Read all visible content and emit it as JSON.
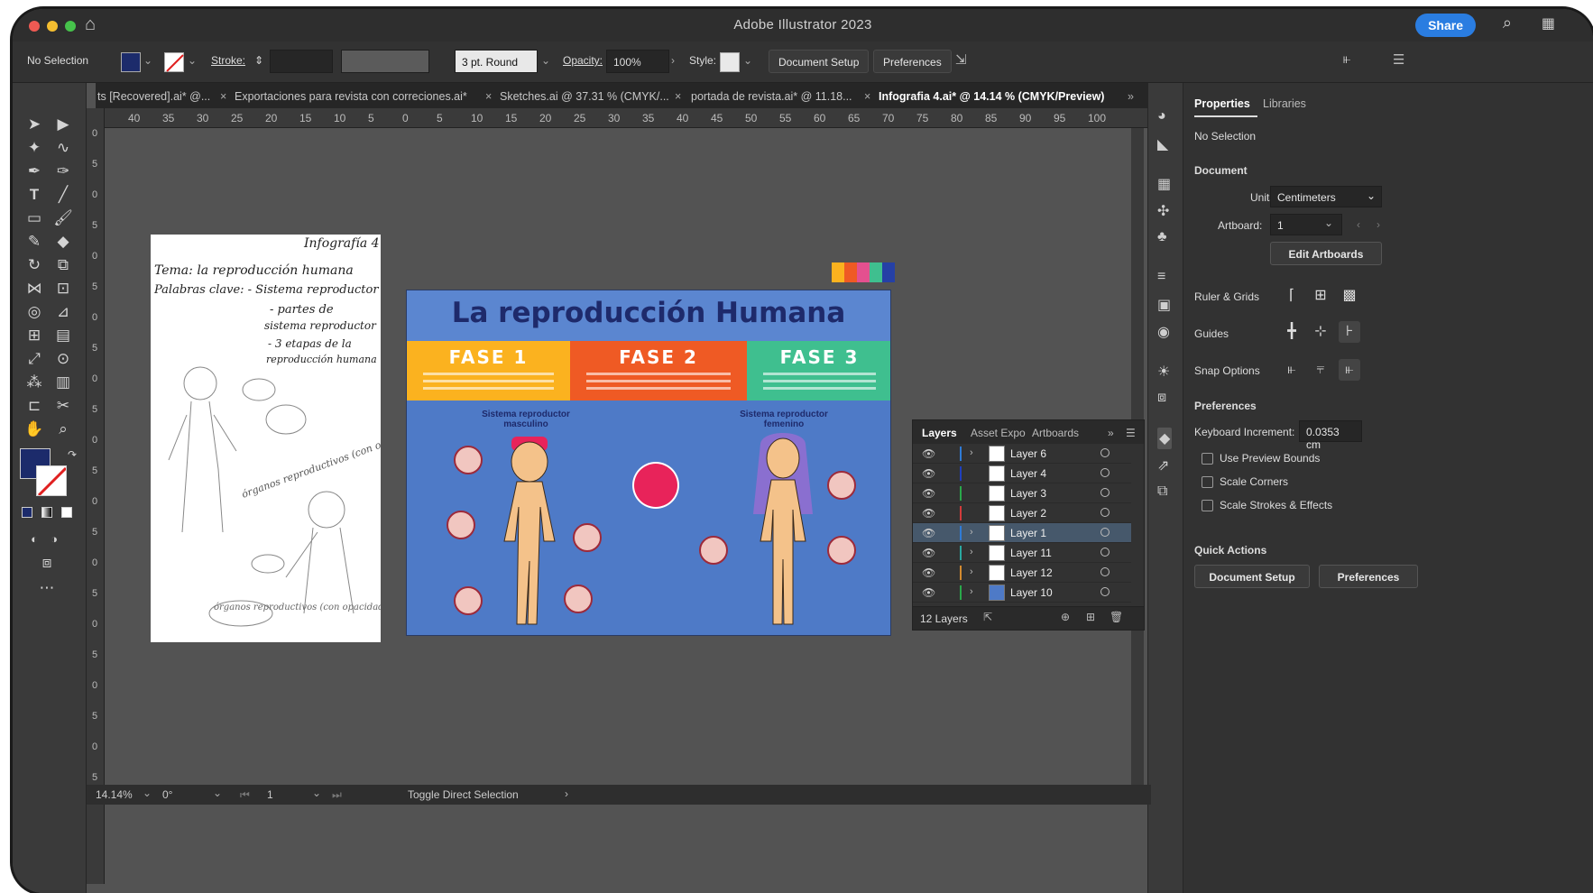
{
  "app": {
    "title": "Adobe Illustrator 2023",
    "share_label": "Share"
  },
  "control_bar": {
    "selection": "No Selection",
    "stroke_label": "Stroke:",
    "brush": "3 pt. Round",
    "opacity_label": "Opacity:",
    "opacity_value": "100%",
    "style_label": "Style:",
    "document_setup": "Document Setup",
    "preferences": "Preferences"
  },
  "tabs": [
    {
      "label": "ts [Recovered].ai* @..."
    },
    {
      "label": "Exportaciones para revista con correciones.ai*"
    },
    {
      "label": "Sketches.ai @ 37.31 % (CMYK/..."
    },
    {
      "label": "portada de revista.ai* @ 11.18..."
    },
    {
      "label": "Infografia 4.ai* @ 14.14 % (CMYK/Preview)"
    }
  ],
  "ruler_h": [
    "40",
    "35",
    "30",
    "25",
    "20",
    "15",
    "10",
    "5",
    "0",
    "5",
    "10",
    "15",
    "20",
    "25",
    "30",
    "35",
    "40",
    "45",
    "50",
    "55",
    "60",
    "65",
    "70",
    "75",
    "80",
    "85",
    "90",
    "95",
    "100"
  ],
  "ruler_v": [
    "0",
    "5",
    "0",
    "5",
    "0",
    "5",
    "0",
    "5",
    "0",
    "5",
    "0",
    "5",
    "0",
    "5",
    "0",
    "5",
    "0",
    "5",
    "0",
    "5",
    "0",
    "5",
    "0",
    "5",
    "0"
  ],
  "sketch": {
    "title": "Infografía 4",
    "tema": "Tema: la reproducción humana",
    "claves": "Palabras clave: - Sistema reproductor",
    "l1": "- partes de",
    "l2": "sistema reproductor",
    "l3": "- 3 etapas de la",
    "l4": "reproducción humana",
    "note1": "órganos reproductivos (con opacidad)",
    "note2": "órganos reproductivos (con opacidad)"
  },
  "infographic": {
    "title": "La reproducción Humana",
    "phases": [
      "FASE 1",
      "FASE 2",
      "FASE 3"
    ],
    "phase_colors": [
      "#fbb21f",
      "#ef5a24",
      "#3fbf8f"
    ],
    "sub_left": "Sistema reproductor masculino",
    "sub_right": "Sistema reproductor femenino"
  },
  "layers_panel": {
    "tabs": [
      "Layers",
      "Asset Expo",
      "Artboards"
    ],
    "rows": [
      {
        "name": "Layer 6",
        "color": "#2f7bd6"
      },
      {
        "name": "Layer 4",
        "color": "#1f3fbd"
      },
      {
        "name": "Layer 3",
        "color": "#2aa84a"
      },
      {
        "name": "Layer 2",
        "color": "#d23b3b"
      },
      {
        "name": "Layer 1",
        "color": "#2f7bd6"
      },
      {
        "name": "Layer 11",
        "color": "#2aa8a0"
      },
      {
        "name": "Layer 12",
        "color": "#d38a2f"
      },
      {
        "name": "Layer 10",
        "color": "#2aa84a"
      }
    ],
    "count": "12 Layers"
  },
  "properties": {
    "tab_properties": "Properties",
    "tab_libraries": "Libraries",
    "no_selection": "No Selection",
    "document": "Document",
    "units_label": "Units:",
    "units_value": "Centimeters",
    "artboard_label": "Artboard:",
    "artboard_value": "1",
    "edit_artboards": "Edit Artboards",
    "rulers_grids": "Ruler & Grids",
    "guides": "Guides",
    "snap_options": "Snap Options",
    "preferences": "Preferences",
    "keyboard_increment_label": "Keyboard Increment:",
    "keyboard_increment_value": "0.0353 cm",
    "use_preview_bounds": "Use Preview Bounds",
    "scale_corners": "Scale Corners",
    "scale_strokes": "Scale Strokes & Effects",
    "quick_actions": "Quick Actions",
    "document_setup": "Document Setup",
    "preferences_btn": "Preferences"
  },
  "status": {
    "zoom": "14.14%",
    "rotation": "0°",
    "artboard": "1",
    "hint": "Toggle Direct Selection"
  }
}
